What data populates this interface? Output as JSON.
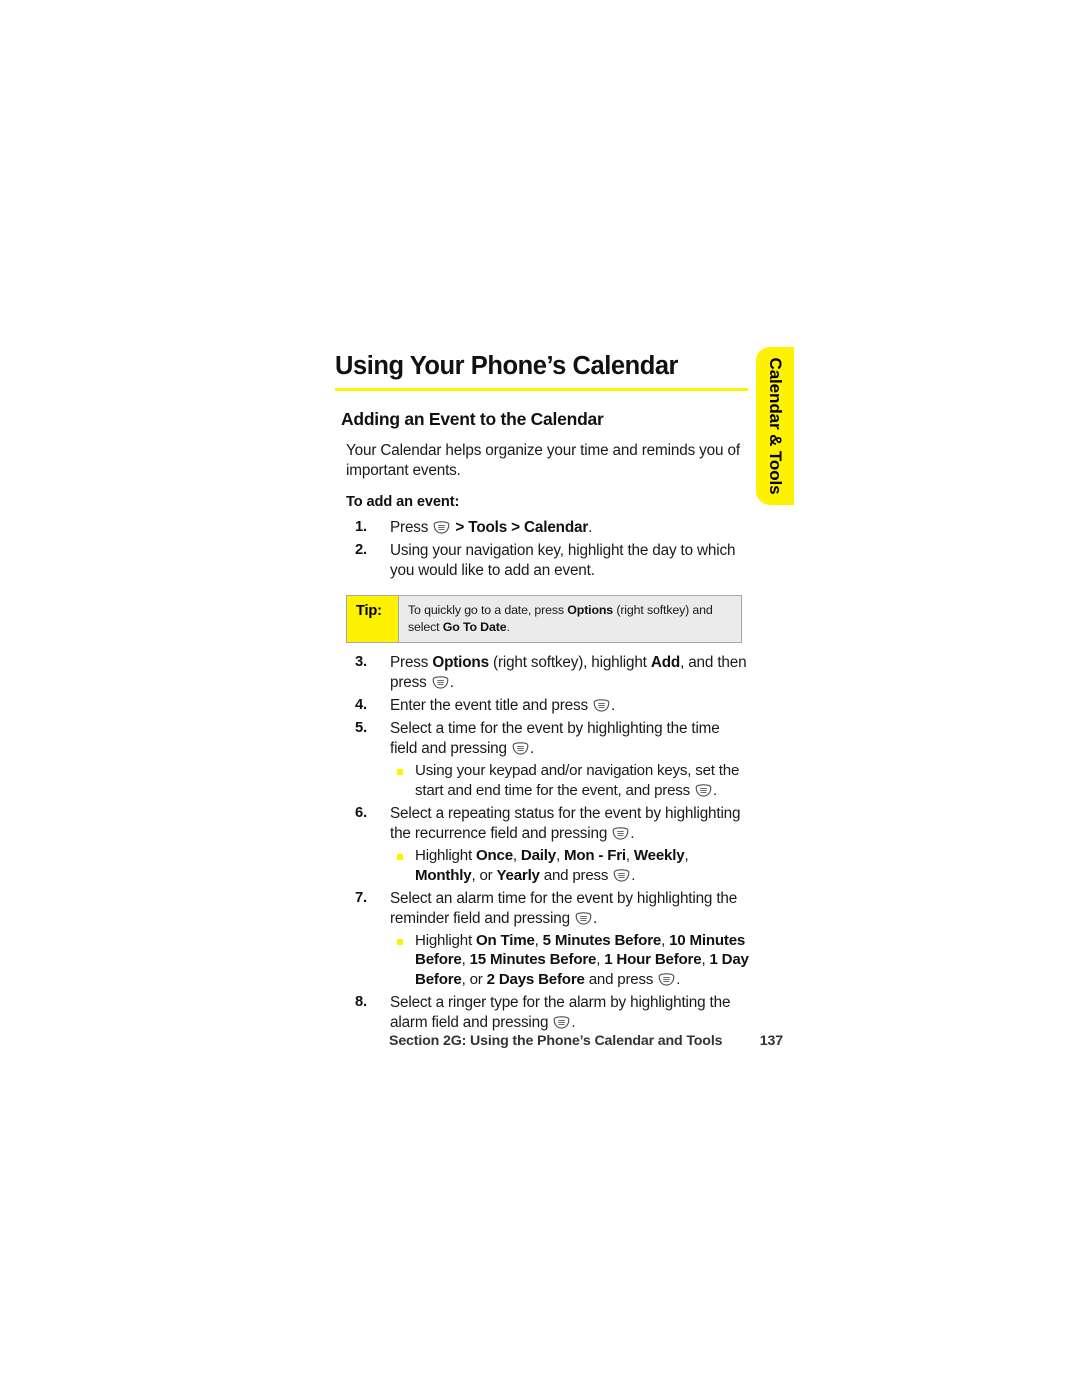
{
  "thumb_tab": {
    "label": "Calendar & Tools",
    "color": "#fff200"
  },
  "chapter": {
    "title": "Using Your Phone’s Calendar"
  },
  "section": {
    "heading": "Adding an Event to the Calendar"
  },
  "intro": "Your Calendar helps organize your time and reminds you of important events.",
  "lead_in": "To add an event:",
  "steps": [
    {
      "num": "1.",
      "parts": [
        {
          "t": "Press ",
          "b": false
        },
        {
          "icon": "select-key-icon"
        },
        {
          "t": " > ",
          "b": true
        },
        {
          "t": "Tools",
          "b": true
        },
        {
          "t": " > ",
          "b": true
        },
        {
          "t": "Calendar",
          "b": true
        },
        {
          "t": ".",
          "b": false
        }
      ]
    },
    {
      "num": "2.",
      "parts": [
        {
          "t": "Using your navigation key, highlight the day to which you would like to add an event.",
          "b": false
        }
      ]
    },
    {
      "num": "3.",
      "parts": [
        {
          "t": "Press ",
          "b": false
        },
        {
          "t": "Options",
          "b": true
        },
        {
          "t": " (right softkey), highlight ",
          "b": false
        },
        {
          "t": "Add",
          "b": true
        },
        {
          "t": ", and then press ",
          "b": false
        },
        {
          "icon": "select-key-icon"
        },
        {
          "t": ".",
          "b": false
        }
      ]
    },
    {
      "num": "4.",
      "parts": [
        {
          "t": "Enter the event title and press ",
          "b": false
        },
        {
          "icon": "select-key-icon"
        },
        {
          "t": ".",
          "b": false
        }
      ]
    },
    {
      "num": "5.",
      "parts": [
        {
          "t": "Select a time for the event by highlighting the time field and pressing ",
          "b": false
        },
        {
          "icon": "select-key-icon"
        },
        {
          "t": ".",
          "b": false
        }
      ],
      "subs": [
        {
          "parts": [
            {
              "t": "Using your keypad and/or navigation keys, set the start and end time for the event, and press ",
              "b": false
            },
            {
              "icon": "select-key-icon"
            },
            {
              "t": ".",
              "b": false
            }
          ]
        }
      ]
    },
    {
      "num": "6.",
      "parts": [
        {
          "t": "Select a repeating status for the event by highlighting the recurrence field and pressing ",
          "b": false
        },
        {
          "icon": "select-key-icon"
        },
        {
          "t": ".",
          "b": false
        }
      ],
      "subs": [
        {
          "parts": [
            {
              "t": "Highlight ",
              "b": false
            },
            {
              "t": "Once",
              "b": true
            },
            {
              "t": ", ",
              "b": false
            },
            {
              "t": "Daily",
              "b": true
            },
            {
              "t": ", ",
              "b": false
            },
            {
              "t": "Mon - Fri",
              "b": true
            },
            {
              "t": ", ",
              "b": false
            },
            {
              "t": "Weekly",
              "b": true
            },
            {
              "t": ", ",
              "b": false
            },
            {
              "t": "Monthly",
              "b": true
            },
            {
              "t": ", or ",
              "b": false
            },
            {
              "t": "Yearly",
              "b": true
            },
            {
              "t": " and press ",
              "b": false
            },
            {
              "icon": "select-key-icon"
            },
            {
              "t": ".",
              "b": false
            }
          ]
        }
      ]
    },
    {
      "num": "7.",
      "parts": [
        {
          "t": "Select an alarm time for the event by highlighting the reminder field and pressing ",
          "b": false
        },
        {
          "icon": "select-key-icon"
        },
        {
          "t": ".",
          "b": false
        }
      ],
      "subs": [
        {
          "parts": [
            {
              "t": "Highlight ",
              "b": false
            },
            {
              "t": "On Time",
              "b": true
            },
            {
              "t": ", ",
              "b": false
            },
            {
              "t": "5 Minutes Before",
              "b": true
            },
            {
              "t": ", ",
              "b": false
            },
            {
              "t": "10 Minutes Before",
              "b": true
            },
            {
              "t": ", ",
              "b": false
            },
            {
              "t": "15 Minutes Before",
              "b": true
            },
            {
              "t": ", ",
              "b": false
            },
            {
              "t": "1 Hour Before",
              "b": true
            },
            {
              "t": ", ",
              "b": false
            },
            {
              "t": "1 Day Before",
              "b": true
            },
            {
              "t": ", or ",
              "b": false
            },
            {
              "t": "2 Days Before",
              "b": true
            },
            {
              "t": " and press ",
              "b": false
            },
            {
              "icon": "select-key-icon"
            },
            {
              "t": ".",
              "b": false
            }
          ]
        }
      ]
    },
    {
      "num": "8.",
      "parts": [
        {
          "t": "Select a ringer type for the alarm by highlighting the alarm field and pressing ",
          "b": false
        },
        {
          "icon": "select-key-icon"
        },
        {
          "t": ".",
          "b": false
        }
      ]
    }
  ],
  "tip": {
    "label": "Tip:",
    "parts": [
      {
        "t": "To quickly go to a date, press ",
        "b": false
      },
      {
        "t": "Options",
        "b": true
      },
      {
        "t": " (right softkey) and select ",
        "b": false
      },
      {
        "t": "Go To Date",
        "b": true
      },
      {
        "t": ".",
        "b": false
      }
    ],
    "after_step": 2
  },
  "footer": {
    "section_text": "Section 2G: Using the Phone’s Calendar and Tools",
    "page_number": "137"
  }
}
